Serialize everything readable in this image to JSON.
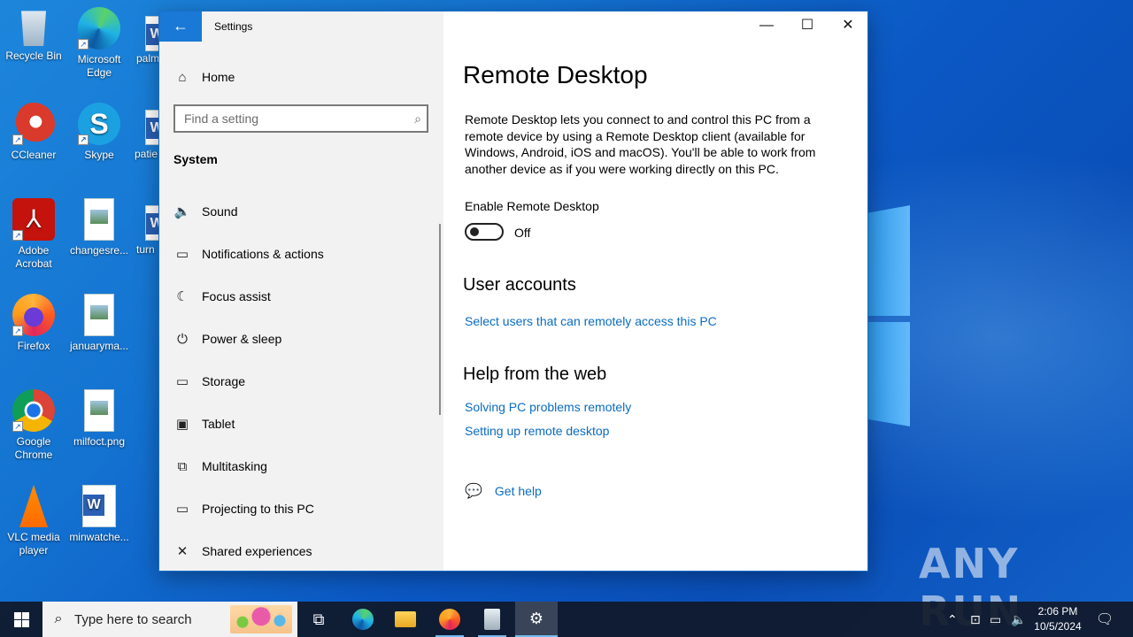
{
  "desktop": {
    "icons": [
      {
        "label_line1": "Recycle Bin",
        "label_line2": "",
        "icon": "recycle-bin-icon"
      },
      {
        "label_line1": "Microsoft",
        "label_line2": "Edge",
        "icon": "edge-icon"
      },
      {
        "label_line1": "CCleaner",
        "label_line2": "",
        "icon": "ccleaner-icon"
      },
      {
        "label_line1": "Skype",
        "label_line2": "",
        "icon": "skype-icon"
      },
      {
        "label_line1": "Adobe",
        "label_line2": "Acrobat",
        "icon": "acrobat-icon"
      },
      {
        "label_line1": "changesre...",
        "label_line2": "",
        "icon": "image-file-icon"
      },
      {
        "label_line1": "Firefox",
        "label_line2": "",
        "icon": "firefox-icon"
      },
      {
        "label_line1": "januaryma...",
        "label_line2": "",
        "icon": "image-file-icon"
      },
      {
        "label_line1": "Google",
        "label_line2": "Chrome",
        "icon": "chrome-icon"
      },
      {
        "label_line1": "milfoct.png",
        "label_line2": "",
        "icon": "image-file-icon"
      },
      {
        "label_line1": "VLC media",
        "label_line2": "player",
        "icon": "vlc-icon"
      },
      {
        "label_line1": "minwatche...",
        "label_line2": "",
        "icon": "word-doc-icon"
      }
    ],
    "partial_icons": [
      "palm",
      "patie",
      "turn"
    ],
    "watermark": "ANY RUN"
  },
  "settings": {
    "window_title": "Settings",
    "back_glyph": "←",
    "controls": {
      "minimize": "—",
      "maximize": "☐",
      "close": "✕"
    },
    "sidebar": {
      "home": "Home",
      "search_placeholder": "Find a setting",
      "section": "System",
      "items": [
        {
          "label": "Sound",
          "icon": "speaker-icon",
          "glyph": "🔈"
        },
        {
          "label": "Notifications & actions",
          "icon": "notifications-icon",
          "glyph": "▭"
        },
        {
          "label": "Focus assist",
          "icon": "moon-icon",
          "glyph": "☾"
        },
        {
          "label": "Power & sleep",
          "icon": "power-icon",
          "glyph": "⏻"
        },
        {
          "label": "Storage",
          "icon": "storage-icon",
          "glyph": "▭"
        },
        {
          "label": "Tablet",
          "icon": "tablet-icon",
          "glyph": "▣"
        },
        {
          "label": "Multitasking",
          "icon": "multitasking-icon",
          "glyph": "⧉"
        },
        {
          "label": "Projecting to this PC",
          "icon": "projecting-icon",
          "glyph": "▭"
        },
        {
          "label": "Shared experiences",
          "icon": "shared-experiences-icon",
          "glyph": "✕"
        }
      ]
    },
    "main": {
      "title": "Remote Desktop",
      "description": "Remote Desktop lets you connect to and control this PC from a remote device by using a Remote Desktop client (available for Windows, Android, iOS and macOS). You'll be able to work from another device as if you were working directly on this PC.",
      "toggle_label": "Enable Remote Desktop",
      "toggle_state": "Off",
      "toggle_on": false,
      "user_accounts_heading": "User accounts",
      "user_accounts_link": "Select users that can remotely access this PC",
      "help_heading": "Help from the web",
      "help_links": [
        "Solving PC problems remotely",
        "Setting up remote desktop"
      ],
      "get_help": "Get help"
    }
  },
  "taskbar": {
    "search_placeholder": "Type here to search",
    "time": "2:06 PM",
    "date": "10/5/2024",
    "pinned": [
      "task-view-icon",
      "edge-icon",
      "file-explorer-icon",
      "firefox-icon",
      "clipboard-app-icon",
      "settings-gear-icon"
    ]
  }
}
